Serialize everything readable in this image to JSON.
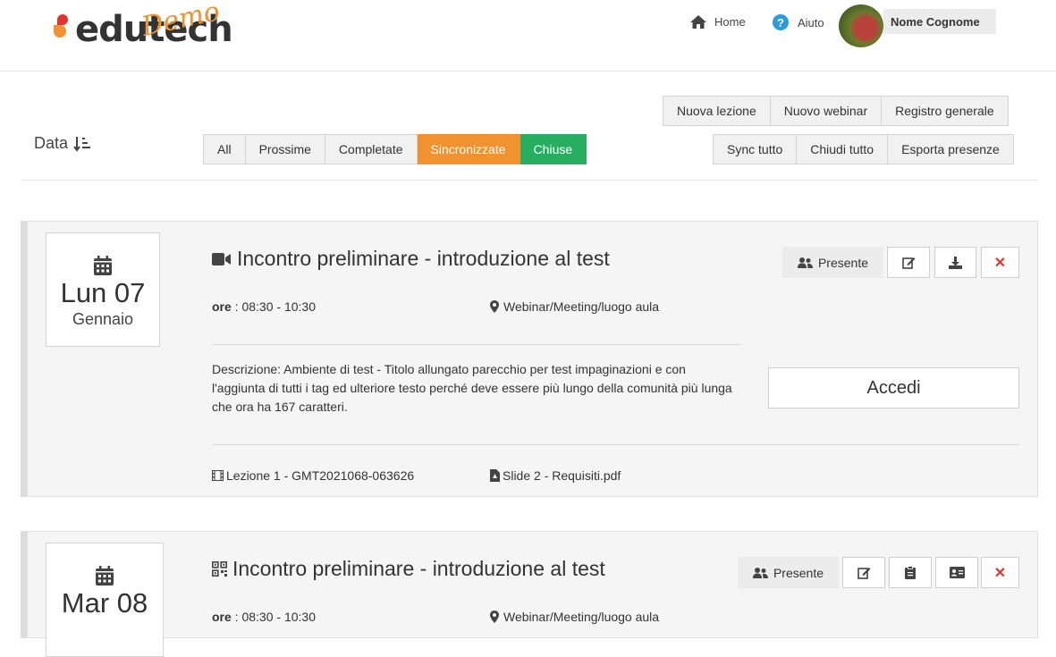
{
  "header": {
    "logo_text": "edutech",
    "logo_badge": "Demo",
    "home_label": "Home",
    "help_label": "Aiuto",
    "user_name": "Nome Cognome"
  },
  "toolbar": {
    "sort_label": "Data",
    "filters": [
      "All",
      "Prossime",
      "Completate",
      "Sincronizzate",
      "Chiuse"
    ],
    "actions_top": [
      "Nuova lezione",
      "Nuovo webinar",
      "Registro generale"
    ],
    "actions_bottom": [
      "Sync tutto",
      "Chiudi tutto",
      "Esporta presenze"
    ]
  },
  "events": [
    {
      "weekday_day": "Lun 07",
      "month": "Gennaio",
      "title": "Incontro preliminare - introduzione al test",
      "ore_label": "ore",
      "ore_value": " : 08:30 - 10:30",
      "place": "Webinar/Meeting/luogo aula",
      "description": "Descrizione: Ambiente di test - Titolo allungato parecchio per test impaginazioni e con l'aggiunta di tutti i tag ed ulteriore testo perché deve essere più lungo della comunità più lunga che ora ha 167 caratteri.",
      "presence_label": "Presente",
      "access_label": "Accedi",
      "file1": "Lezione 1 - GMT2021068-063626",
      "file2": "Slide 2 - Requisiti.pdf"
    },
    {
      "weekday_day": "Mar 08",
      "month": "",
      "title": "Incontro preliminare - introduzione al test",
      "ore_label": "ore",
      "ore_value": " : 08:30 - 10:30",
      "place": "Webinar/Meeting/luogo aula",
      "presence_label": "Presente"
    }
  ],
  "colors": {
    "accent_orange": "#f0922e",
    "accent_green": "#27ae60",
    "danger": "#e0342e"
  }
}
